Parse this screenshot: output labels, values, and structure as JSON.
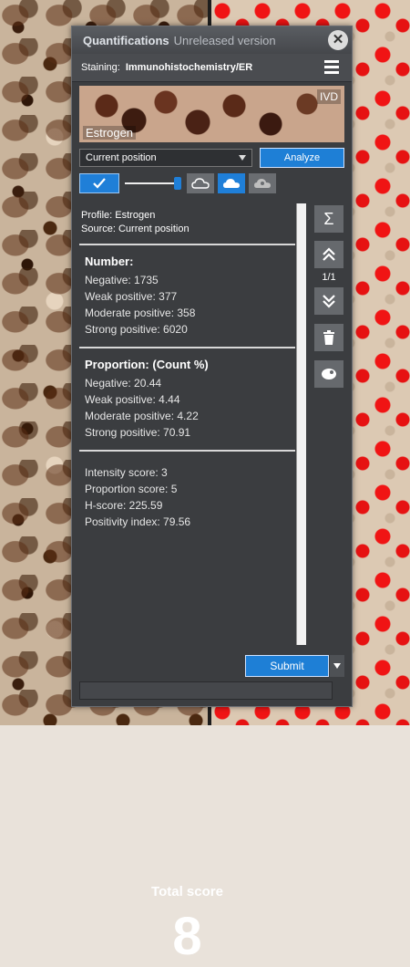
{
  "window": {
    "title": "Quantifications",
    "subtitle": "Unreleased version",
    "close_glyph": "✕"
  },
  "staining": {
    "label": "Staining:",
    "value": "Immunohistochemistry/ER"
  },
  "thumbnail": {
    "badge": "IVD",
    "caption": "Estrogen"
  },
  "controls": {
    "position_select": "Current position",
    "analyze_label": "Analyze",
    "slider_fraction": 1.0
  },
  "profile": {
    "profile_line": "Profile: Estrogen",
    "source_line": "Source: Current position"
  },
  "number": {
    "title": "Number:",
    "negative": "Negative: 1735",
    "weak": "Weak positive: 377",
    "moderate": "Moderate positive: 358",
    "strong": "Strong positive: 6020"
  },
  "proportion": {
    "title": "Proportion: (Count %)",
    "negative": "Negative: 20.44",
    "weak": "Weak positive: 4.44",
    "moderate": "Moderate positive: 4.22",
    "strong": "Strong positive: 70.91"
  },
  "scores": {
    "intensity": "Intensity score: 3",
    "proportion": "Proportion score: 5",
    "hscore": "H-score: 225.59",
    "positivity": "Positivity index: 79.56"
  },
  "total": {
    "label": "Total score",
    "value": "8"
  },
  "side": {
    "sum_icon": "Σ",
    "pager": "1/1"
  },
  "actions": {
    "submit_label": "Submit"
  },
  "colors": {
    "accent": "#1f7fd8",
    "panel": "#3b3d40"
  }
}
